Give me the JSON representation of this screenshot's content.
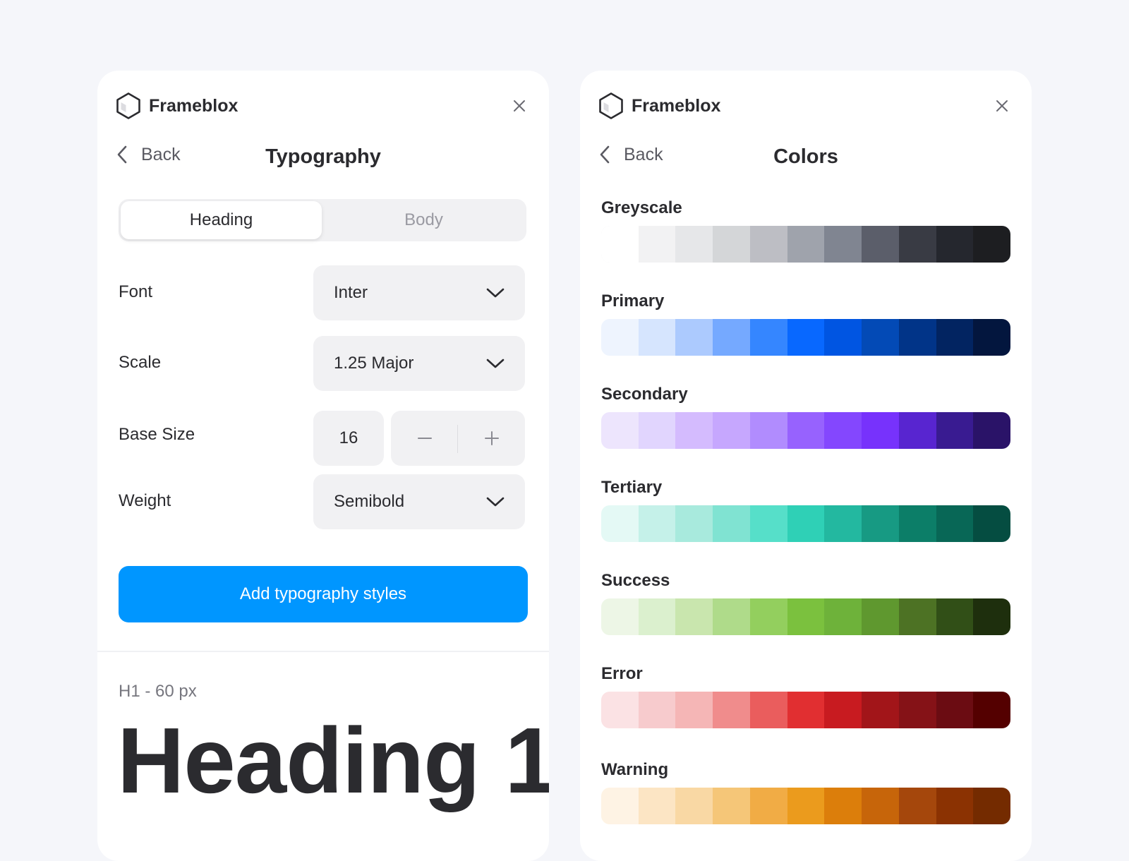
{
  "typography_panel": {
    "brand": "Frameblox",
    "back_label": "Back",
    "title": "Typography",
    "tabs": [
      {
        "label": "Heading",
        "active": true
      },
      {
        "label": "Body",
        "active": false
      }
    ],
    "rows": [
      {
        "label": "Font",
        "value": "Inter",
        "icon": "chevron-down-icon"
      },
      {
        "label": "Scale",
        "value": "1.25 Major",
        "icon": "chevron-down-icon"
      },
      {
        "label": "Base Size",
        "value": "16",
        "icons": [
          "minus-icon",
          "plus-icon"
        ]
      },
      {
        "label": "Weight",
        "value": "Semibold",
        "icon": "chevron-down-icon"
      }
    ],
    "cta_label": "Add typography styles",
    "preview": {
      "meta": "H1 - 60 px",
      "sample": "Heading 1"
    }
  },
  "colors_panel": {
    "brand": "Frameblox",
    "back_label": "Back",
    "title": "Colors",
    "palettes": [
      {
        "name": "Greyscale",
        "swatches": [
          "#ffffff",
          "#f2f2f3",
          "#e6e7e9",
          "#d4d6d8",
          "#bdbec4",
          "#9fa3ac",
          "#808591",
          "#5b5e6a",
          "#393b44",
          "#25272e",
          "#1d1e21"
        ]
      },
      {
        "name": "Primary",
        "swatches": [
          "#eef4fe",
          "#d6e5fe",
          "#accafe",
          "#75a9ff",
          "#3586ff",
          "#0868ff",
          "#0055e2",
          "#034ab6",
          "#013488",
          "#022461",
          "#03163e"
        ]
      },
      {
        "name": "Secondary",
        "swatches": [
          "#ede5fd",
          "#e1d5fe",
          "#d4bbfe",
          "#c6a7fe",
          "#b18cfe",
          "#9762fe",
          "#8447fe",
          "#7732fc",
          "#5825d0",
          "#391b91",
          "#2a1368"
        ]
      },
      {
        "name": "Tertiary",
        "swatches": [
          "#e4f9f5",
          "#c5f1e9",
          "#a8eadd",
          "#80e3d2",
          "#56dfc9",
          "#2fd0b6",
          "#23b8a0",
          "#179a83",
          "#0c7e68",
          "#086756",
          "#054d41"
        ]
      },
      {
        "name": "Success",
        "swatches": [
          "#edf6e6",
          "#dbf0ce",
          "#c9e6ae",
          "#afdb8a",
          "#93cf5e",
          "#7bc13e",
          "#6eb23a",
          "#5f982f",
          "#4d7224",
          "#314f17",
          "#1e2f0d"
        ]
      },
      {
        "name": "Error",
        "swatches": [
          "#fbe2e4",
          "#f7cbcd",
          "#f5b6b6",
          "#f08c8c",
          "#ea5d5d",
          "#e12f31",
          "#c81b20",
          "#a21519",
          "#851217",
          "#6b0c12",
          "#540000"
        ]
      },
      {
        "name": "Warning",
        "swatches": [
          "#fef3e4",
          "#fce5c4",
          "#f9d8a4",
          "#f5c678",
          "#f1ac45",
          "#eb9b1d",
          "#dc7e0b",
          "#c7650a",
          "#a5470c",
          "#8b3202",
          "#742b00"
        ]
      }
    ]
  },
  "colors": {
    "accent": "#0096ff",
    "background": "#f5f6fa",
    "surface": "#ffffff",
    "control": "#f1f1f3"
  }
}
